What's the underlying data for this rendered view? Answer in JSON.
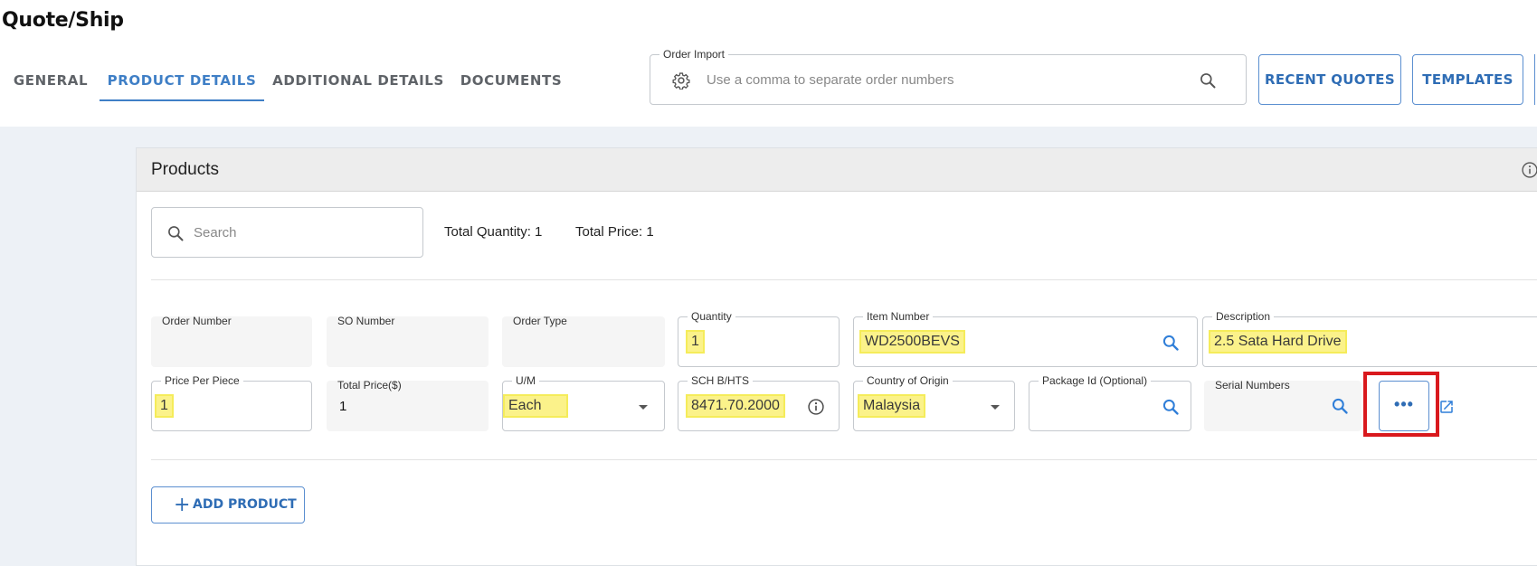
{
  "header": {
    "title": "Quote/Ship"
  },
  "tabs": [
    {
      "label": "GENERAL",
      "active": false
    },
    {
      "label": "PRODUCT DETAILS",
      "active": true
    },
    {
      "label": "ADDITIONAL DETAILS",
      "active": false
    },
    {
      "label": "DOCUMENTS",
      "active": false
    }
  ],
  "order_import": {
    "label": "Order Import",
    "placeholder": "Use a comma to separate order numbers"
  },
  "buttons": {
    "recent_quotes": "RECENT QUOTES",
    "templates": "TEMPLATES",
    "add_product": "ADD PRODUCT"
  },
  "products": {
    "title": "Products",
    "search_placeholder": "Search",
    "total_quantity": "Total Quantity: 1",
    "total_price": "Total Price: 1"
  },
  "fields": {
    "order_number": {
      "label": "Order Number",
      "value": ""
    },
    "so_number": {
      "label": "SO Number",
      "value": ""
    },
    "order_type": {
      "label": "Order Type",
      "value": ""
    },
    "quantity": {
      "label": "Quantity",
      "value": "1"
    },
    "item_number": {
      "label": "Item Number",
      "value": "WD2500BEVS"
    },
    "description": {
      "label": "Description",
      "value": "2.5 Sata Hard Drive"
    },
    "price_per_piece": {
      "label": "Price Per Piece",
      "value": "1"
    },
    "total_price": {
      "label": "Total Price($)",
      "value": "1"
    },
    "um": {
      "label": "U/M",
      "value": "Each"
    },
    "sch_hts": {
      "label": "SCH B/HTS",
      "value": "8471.70.2000"
    },
    "country_of_origin": {
      "label": "Country of Origin",
      "value": "Malaysia"
    },
    "package_id": {
      "label": "Package Id (Optional)",
      "value": ""
    },
    "serial_numbers": {
      "label": "Serial Numbers",
      "value": ""
    }
  },
  "icons": {
    "more": "ellipsis-icon",
    "open_external": "open-in-new-icon",
    "gear": "gear-icon",
    "search": "search-icon",
    "info": "info-icon"
  },
  "colors": {
    "accent": "#3f7fc6",
    "highlight": "#fbf28a",
    "red_annotation": "#d9191d",
    "page_bg": "#edf1f6"
  }
}
